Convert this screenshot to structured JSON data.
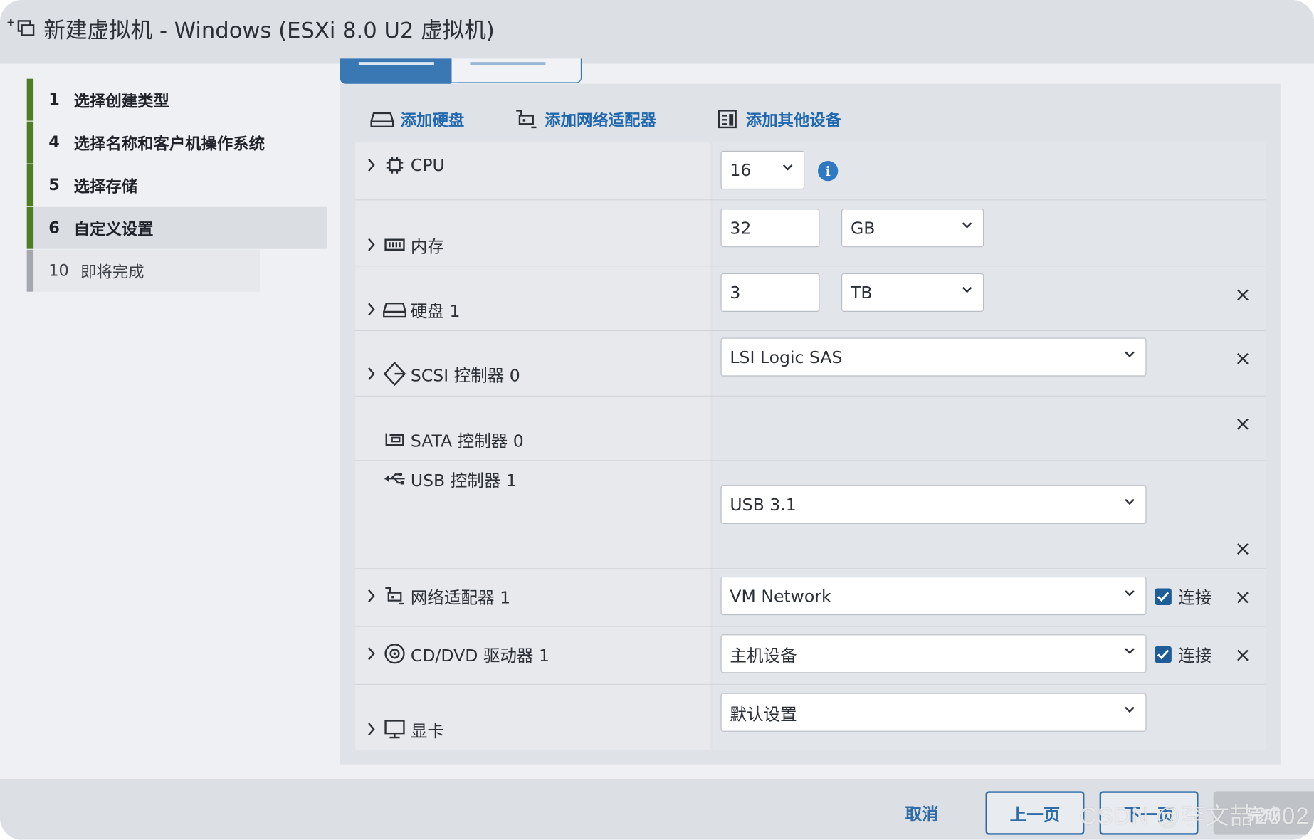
{
  "window": {
    "title": "新建虚拟机 - Windows (ESXi 8.0 U2 虚拟机)"
  },
  "nav": {
    "items": [
      {
        "num": "1",
        "label": "选择创建类型",
        "state": "done"
      },
      {
        "num": "4",
        "label": "选择名称和客户机操作系统",
        "state": "done"
      },
      {
        "num": "5",
        "label": "选择存储",
        "state": "done"
      },
      {
        "num": "6",
        "label": "自定义设置",
        "state": "active"
      },
      {
        "num": "10",
        "label": "即将完成",
        "state": "pending"
      }
    ]
  },
  "toolbar": {
    "add_disk": "添加硬盘",
    "add_nic": "添加网络适配器",
    "add_other": "添加其他设备"
  },
  "hardware": {
    "cpu": {
      "label": "CPU",
      "value": "16"
    },
    "memory": {
      "label": "内存",
      "value": "32",
      "unit": "GB"
    },
    "disk": {
      "label": "硬盘 1",
      "value": "3",
      "unit": "TB"
    },
    "scsi": {
      "label": "SCSI 控制器 0",
      "value": "LSI Logic SAS"
    },
    "sata": {
      "label": "SATA 控制器 0"
    },
    "usb": {
      "label": "USB 控制器 1",
      "value": "USB 3.1"
    },
    "nic": {
      "label": "网络适配器 1",
      "value": "VM Network",
      "connect_label": "连接",
      "connected": true
    },
    "cdrom": {
      "label": "CD/DVD 驱动器 1",
      "value": "主机设备",
      "connect_label": "连接",
      "connected": true
    },
    "video": {
      "label": "显卡",
      "value": "默认设置"
    }
  },
  "footer": {
    "cancel": "取消",
    "prev": "上一页",
    "next": "下一页",
    "finish": "完成"
  },
  "watermark": "CSDN @李文喆2002",
  "colors": {
    "accent": "#1f67ae",
    "nav_done": "#4e7e23",
    "checkbox": "#1f5d99"
  }
}
